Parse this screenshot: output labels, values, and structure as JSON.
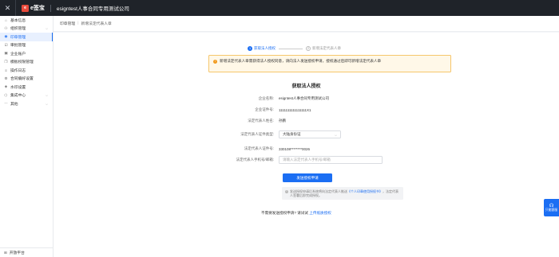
{
  "topbar": {
    "close_icon": "close-icon",
    "logo_mark": "e",
    "logo_text": "e签宝",
    "org_name": "esigntest人事合同专用测试公司"
  },
  "sidebar": {
    "items": [
      {
        "label": "基本信息",
        "icon": "home-icon",
        "active": false,
        "chevron": false
      },
      {
        "label": "组织管理",
        "icon": "org-icon",
        "active": false,
        "chevron": true
      },
      {
        "label": "印章管理",
        "icon": "seal-icon",
        "active": true,
        "chevron": false
      },
      {
        "label": "审批管理",
        "icon": "approval-icon",
        "active": false,
        "chevron": false
      },
      {
        "label": "企业账户",
        "icon": "account-icon",
        "active": false,
        "chevron": false
      },
      {
        "label": "模板权限管理",
        "icon": "template-icon",
        "active": false,
        "chevron": false
      },
      {
        "label": "操作日志",
        "icon": "log-icon",
        "active": false,
        "chevron": false
      },
      {
        "label": "合同偏好设置",
        "icon": "settings-icon",
        "active": false,
        "chevron": false
      },
      {
        "label": "水印设置",
        "icon": "watermark-icon",
        "active": false,
        "chevron": false
      },
      {
        "label": "集成中心",
        "icon": "integration-icon",
        "active": false,
        "chevron": true
      },
      {
        "label": "其他",
        "icon": "more-icon",
        "active": false,
        "chevron": true
      }
    ],
    "footer_label": "开放平台"
  },
  "breadcrumb": {
    "parent": "印章管理",
    "separator": "|",
    "current": "新增法定代表人章"
  },
  "steps": [
    {
      "num": "1",
      "label": "获取法人授权",
      "active": true
    },
    {
      "num": "2",
      "label": "新增法定代表人章",
      "active": false
    }
  ],
  "notice": {
    "text": "新增法定代表人章需获得法人授权同意，请向法人发送授权申请，授权通过后即可新增法定代表人章"
  },
  "form": {
    "title": "获取法人授权",
    "fields": [
      {
        "label": "企业名称:",
        "value": "esigntest人事合同专用测试公司",
        "kind": "text"
      },
      {
        "label": "企业证件号:",
        "value": "1111111111111111X1",
        "kind": "text"
      },
      {
        "label": "法定代表人姓名:",
        "value": "孙鹏",
        "kind": "text"
      },
      {
        "label": "法定代表人证件类型:",
        "value": "大陆身份证",
        "kind": "select"
      },
      {
        "label": "法定代表人证件号:",
        "value": "330108********0026",
        "kind": "text"
      },
      {
        "label": "法定代表人手机号/邮箱:",
        "placeholder": "请输入法定代表人手机号/邮箱",
        "kind": "input"
      }
    ],
    "submit_label": "发送授权申请"
  },
  "tip": {
    "prefix": "发送授权申请后系统将向法定代表人推送",
    "link": "《个人印章使用授权书》",
    "suffix": "，法定代表人签署后即完成授权。"
  },
  "bottom": {
    "question": "不需要发送授权申请? 请试试",
    "link": "上传纸质授权"
  },
  "float_button": {
    "label": "只能客服"
  }
}
